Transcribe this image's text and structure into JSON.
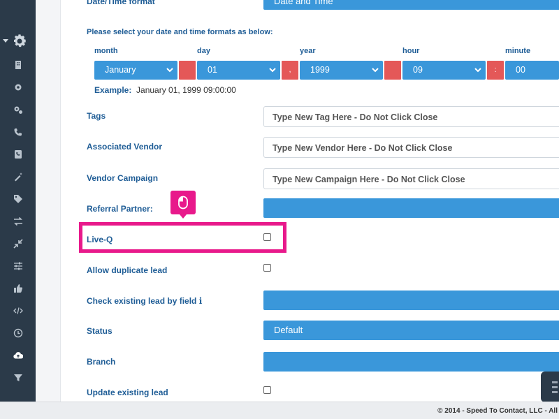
{
  "top_field": {
    "label": "Date/Time format",
    "value": "Date and Time"
  },
  "datetime": {
    "instruction": "Please select your date and time formats as below:",
    "columns": [
      {
        "header": "month",
        "value": "January"
      },
      {
        "header": "day",
        "value": "01"
      },
      {
        "header": "year",
        "value": "1999"
      },
      {
        "header": "hour",
        "value": "09"
      },
      {
        "header": "minute",
        "value": "00"
      }
    ],
    "separators": [
      "",
      ",",
      "",
      ":"
    ],
    "example_label": "Example:",
    "example_value": "January 01, 1999 09:00:00"
  },
  "fields": {
    "tags": {
      "label": "Tags",
      "placeholder": "Type New Tag Here - Do Not Click Close"
    },
    "vendor": {
      "label": "Associated Vendor",
      "placeholder": "Type New Vendor Here - Do Not Click Close"
    },
    "campaign": {
      "label": "Vendor Campaign",
      "placeholder": "Type New Campaign Here - Do Not Click Close"
    },
    "referral": {
      "label": "Referral Partner:",
      "value": ""
    },
    "liveq": {
      "label": "Live-Q",
      "checked": false
    },
    "duplicate": {
      "label": "Allow duplicate lead",
      "checked": false
    },
    "check_existing": {
      "label": "Check existing lead by field",
      "info": "i",
      "value": ""
    },
    "status": {
      "label": "Status",
      "value": "Default"
    },
    "branch": {
      "label": "Branch",
      "value": ""
    },
    "update_existing": {
      "label": "Update existing lead",
      "checked": false
    }
  },
  "footer": {
    "text": "© 2014 - Speed To Contact, LLC - All"
  },
  "colors": {
    "sidebar": "#2b3a49",
    "accent": "#3a97da",
    "separator": "#e45858",
    "highlight": "#e8198b",
    "label": "#1f5d96"
  },
  "sidebar_icons": [
    "gear-icon",
    "building-icon",
    "settings-icon",
    "gears-icon",
    "phone-icon",
    "phone-book-icon",
    "magic-wand-icon",
    "tag-icon",
    "transfer-icon",
    "compress-icon",
    "sliders-icon",
    "thumbs-up-icon",
    "code-icon",
    "clock-icon",
    "cloud-upload-icon",
    "filter-icon"
  ]
}
